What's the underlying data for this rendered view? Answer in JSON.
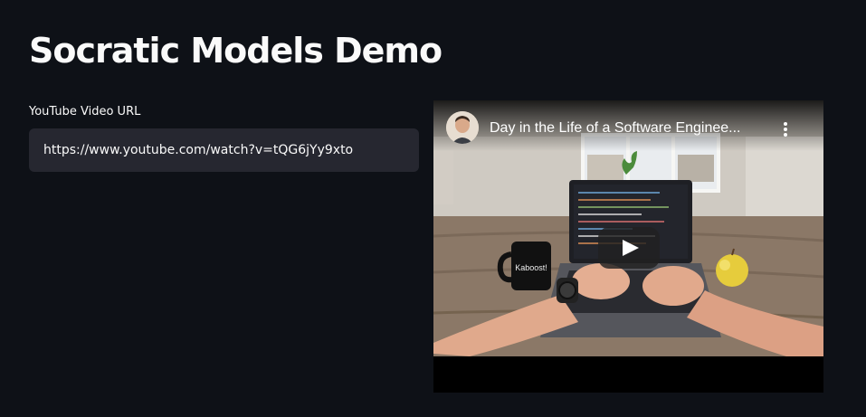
{
  "page": {
    "title": "Socratic Models Demo"
  },
  "url_field": {
    "label": "YouTube Video URL",
    "value": "https://www.youtube.com/watch?v=tQG6jYy9xto"
  },
  "video": {
    "title": "Day in the Life of a Software Enginee...",
    "mug_text": "Kaboost!",
    "icons": {
      "play": "play-icon",
      "more": "more-vertical-icon"
    }
  }
}
